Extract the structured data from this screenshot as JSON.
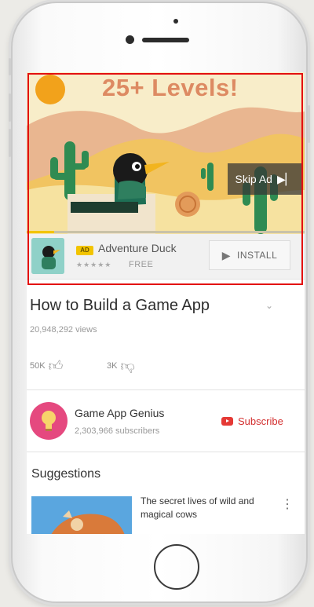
{
  "ad": {
    "video_title": "25+ Levels!",
    "skip_label": "Skip Ad",
    "progress": 0.1,
    "badge": "AD",
    "app_name": "Adventure Duck",
    "rating_stars": "★★★★★",
    "price": "FREE",
    "install_label": "INSTALL"
  },
  "video": {
    "title": "How to Build a Game App",
    "views": "20,948,292 views",
    "likes": "50K",
    "dislikes": "3K"
  },
  "channel": {
    "name": "Game App Genius",
    "subscribers": "2,303,966 subscribers",
    "subscribe_label": "Subscribe"
  },
  "suggestions": {
    "heading": "Suggestions",
    "items": [
      {
        "title": "The secret lives of wild and magical cows"
      }
    ]
  },
  "colors": {
    "highlight": "#e31010",
    "subscribe": "#d32f2f",
    "ad_badge": "#f2c400"
  },
  "icons": {
    "skip": "skip-next-icon",
    "install": "play-icon",
    "like": "thumbs-up-icon",
    "dislike": "thumbs-down-icon",
    "expand": "chevron-down-icon",
    "subscribe": "youtube-icon",
    "more": "more-vertical-icon"
  }
}
